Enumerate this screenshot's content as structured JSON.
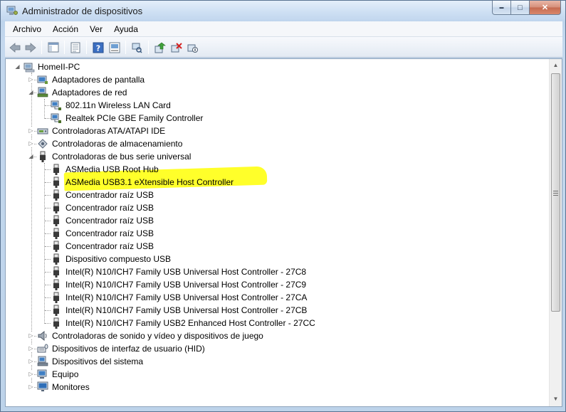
{
  "window": {
    "title": "Administrador de dispositivos",
    "controls": {
      "minimize": "▬",
      "maximize": "□",
      "close": "✕"
    }
  },
  "menu": [
    "Archivo",
    "Acción",
    "Ver",
    "Ayuda"
  ],
  "toolbar": {
    "buttons": [
      "back-icon",
      "forward-icon",
      "console-tree-icon",
      "properties-icon",
      "help-icon",
      "show-hidden-icon",
      "scan-hardware-icon",
      "update-driver-icon",
      "uninstall-icon",
      "disable-icon"
    ]
  },
  "tree": {
    "root": "HomeII-PC",
    "items": [
      {
        "label": "Adaptadores de pantalla",
        "level": 1,
        "state": "collapsed",
        "icon": "display-adapter-icon"
      },
      {
        "label": "Adaptadores de red",
        "level": 1,
        "state": "expanded",
        "icon": "network-adapter-icon"
      },
      {
        "label": "802.11n Wireless LAN Card",
        "level": 2,
        "icon": "network-card-icon"
      },
      {
        "label": "Realtek PCIe GBE Family Controller",
        "level": 2,
        "icon": "network-card-icon"
      },
      {
        "label": "Controladoras ATA/ATAPI IDE",
        "level": 1,
        "state": "collapsed",
        "icon": "ide-controller-icon"
      },
      {
        "label": "Controladoras de almacenamiento",
        "level": 1,
        "state": "collapsed",
        "icon": "storage-controller-icon"
      },
      {
        "label": "Controladoras de bus serie universal",
        "level": 1,
        "state": "expanded",
        "icon": "usb-plug-icon"
      },
      {
        "label": "ASMedia USB Root Hub",
        "level": 2,
        "icon": "usb-plug-icon"
      },
      {
        "label": "ASMedia USB3.1 eXtensible Host Controller",
        "level": 2,
        "icon": "usb-plug-icon",
        "highlighted": true
      },
      {
        "label": "Concentrador raíz USB",
        "level": 2,
        "icon": "usb-plug-icon"
      },
      {
        "label": "Concentrador raíz USB",
        "level": 2,
        "icon": "usb-plug-icon"
      },
      {
        "label": "Concentrador raíz USB",
        "level": 2,
        "icon": "usb-plug-icon"
      },
      {
        "label": "Concentrador raíz USB",
        "level": 2,
        "icon": "usb-plug-icon"
      },
      {
        "label": "Concentrador raíz USB",
        "level": 2,
        "icon": "usb-plug-icon"
      },
      {
        "label": "Dispositivo compuesto USB",
        "level": 2,
        "icon": "usb-plug-icon"
      },
      {
        "label": "Intel(R) N10/ICH7 Family USB Universal Host Controller - 27C8",
        "level": 2,
        "icon": "usb-plug-icon"
      },
      {
        "label": "Intel(R) N10/ICH7 Family USB Universal Host Controller - 27C9",
        "level": 2,
        "icon": "usb-plug-icon"
      },
      {
        "label": "Intel(R) N10/ICH7 Family USB Universal Host Controller - 27CA",
        "level": 2,
        "icon": "usb-plug-icon"
      },
      {
        "label": "Intel(R) N10/ICH7 Family USB Universal Host Controller - 27CB",
        "level": 2,
        "icon": "usb-plug-icon"
      },
      {
        "label": "Intel(R) N10/ICH7 Family USB2 Enhanced Host Controller - 27CC",
        "level": 2,
        "icon": "usb-plug-icon"
      },
      {
        "label": "Controladoras de sonido y vídeo y dispositivos de juego",
        "level": 1,
        "state": "collapsed",
        "icon": "speaker-icon"
      },
      {
        "label": "Dispositivos de interfaz de usuario (HID)",
        "level": 1,
        "state": "collapsed",
        "icon": "hid-icon"
      },
      {
        "label": "Dispositivos del sistema",
        "level": 1,
        "state": "collapsed",
        "icon": "system-device-icon"
      },
      {
        "label": "Equipo",
        "level": 1,
        "state": "collapsed",
        "icon": "computer-icon"
      },
      {
        "label": "Monitores",
        "level": 1,
        "state": "collapsed",
        "icon": "monitor-icon"
      }
    ]
  },
  "colors": {
    "highlight": "#ffff2a",
    "titlebar": "#cddff3"
  }
}
